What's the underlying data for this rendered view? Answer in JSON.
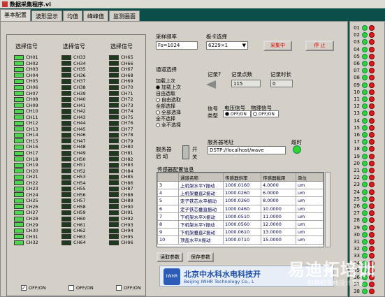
{
  "window": {
    "title": "数据采集程序.vi"
  },
  "tabs": [
    "基本配置",
    "波形显示",
    "均值",
    "峰峰值",
    "监测画面"
  ],
  "channels": {
    "column_header": "选择信号",
    "col1": [
      "CH01",
      "CH02",
      "CH03",
      "CH04",
      "CH05",
      "CH06",
      "CH07",
      "CH08",
      "CH09",
      "CH10",
      "CH11",
      "CH12",
      "CH13",
      "CH14",
      "CH15",
      "CH16",
      "CH17",
      "CH18",
      "CH19",
      "CH20",
      "CH21",
      "CH22",
      "CH23",
      "CH24",
      "CH25",
      "CH26",
      "CH27",
      "CH28",
      "CH29",
      "CH30",
      "CH31",
      "CH32"
    ],
    "col2": [
      "CH33",
      "CH34",
      "CH35",
      "CH36",
      "CH37",
      "CH38",
      "CH39",
      "CH40",
      "CH41",
      "CH42",
      "CH43",
      "CH44",
      "CH45",
      "CH46",
      "CH47",
      "CH48",
      "CH49",
      "CH50",
      "CH51",
      "CH52",
      "CH53",
      "CH54",
      "CH55",
      "CH56",
      "CH57",
      "CH58",
      "CH59",
      "CH60",
      "CH61",
      "CH62",
      "CH63",
      "CH64"
    ],
    "col3": [
      "CH65",
      "CH66",
      "CH67",
      "CH68",
      "CH69",
      "CH70",
      "CH71",
      "CH72",
      "CH73",
      "CH74",
      "CH75",
      "CH76",
      "CH77",
      "CH78",
      "CH79",
      "CH80",
      "CH81",
      "CH82",
      "CH83",
      "CH84",
      "CH85",
      "CH86",
      "CH87",
      "CH88",
      "CH89",
      "CH90",
      "CH91",
      "CH92",
      "CH93",
      "CH94",
      "CH95",
      "CH96"
    ],
    "col1_state": "on",
    "col2_state": "off",
    "col3_state": "off",
    "offon1": "OFF/ON",
    "offon2": "OFF/ON",
    "offon3": "OFF/ON",
    "offon1_checked": "✓"
  },
  "sampling": {
    "label": "采样频率",
    "value": "Fs=1024"
  },
  "board": {
    "label": "板卡选择",
    "value": "6229×1"
  },
  "buttons": {
    "collecting": "采集中",
    "stop": "停 止",
    "read_params": "读取参数",
    "save_params": "保存参数"
  },
  "channel_select": {
    "label": "通道选择",
    "options": [
      "加载上次",
      "自由选取",
      "全部选择",
      "全不选择"
    ],
    "sub_options": [
      "加载上次",
      "自由选取",
      "全部选择",
      "全不选择"
    ],
    "selected_index": 0
  },
  "record": {
    "label": "记录?",
    "points_label": "记录点数",
    "points_value": "115",
    "duration_label": "记录时长",
    "duration_value": "0"
  },
  "signal": {
    "type_label": "信号类型",
    "voltage_label": "电压信号",
    "voltage_value": "OFF/ON",
    "physical_label": "物理信号",
    "physical_value": "OFF/ON"
  },
  "server": {
    "start_label": "服务器启 动",
    "on": "开",
    "off": "关",
    "address_label": "服务器地址",
    "address_value": "DSTP://localhost/wave",
    "timeout_label": "超时"
  },
  "sensor_config": {
    "label": "传感器配置信息",
    "headers": [
      "",
      "通道名称",
      "传感器斜率",
      "传感器截距",
      "单位"
    ],
    "rows": [
      [
        "3",
        "上机架水平Y振动",
        "1000.0160",
        "4.0000",
        "um"
      ],
      [
        "4",
        "上机架垂直Z振动",
        "1000.0260",
        "6.0000",
        "um"
      ],
      [
        "5",
        "定子铁芯水平振动",
        "1000.0360",
        "8.0000",
        "um"
      ],
      [
        "6",
        "定子铁芯垂直振动",
        "1000.0460",
        "10.0000",
        "um"
      ],
      [
        "7",
        "下机架水平X振动",
        "1000.0510",
        "11.0000",
        "um"
      ],
      [
        "8",
        "下机架水平Y振动",
        "1000.0560",
        "12.0000",
        "um"
      ],
      [
        "9",
        "下机架垂直Z振动",
        "1000.0610",
        "13.0000",
        "um"
      ],
      [
        "10",
        "顶盖水平X振动",
        "1000.0710",
        "15.0000",
        "um"
      ]
    ]
  },
  "logo": {
    "company": "北京中水科水电科技开",
    "company_en": "Beijing IWHR Technology Co., L",
    "icon_text": "IWHR"
  },
  "status_leds": {
    "numbers": [
      "01",
      "02",
      "03",
      "04",
      "05",
      "06",
      "07",
      "08",
      "09",
      "10",
      "11",
      "12",
      "13",
      "14",
      "15",
      "16",
      "17",
      "18",
      "19",
      "20",
      "21",
      "22",
      "23",
      "24",
      "25",
      "26",
      "27",
      "28",
      "29",
      "30",
      "31",
      "32",
      "33",
      "34",
      "35",
      "36",
      "37",
      "38"
    ]
  },
  "watermark": {
    "text": "易迪拓培训",
    "sub": "射频和天线设计专家"
  },
  "colors": {
    "led_on": "#4cd64c",
    "led_off": "#1e3a1e",
    "status_green": "#2fd42f",
    "status_red": "#e21a1a",
    "background": "#0b4e4a"
  }
}
